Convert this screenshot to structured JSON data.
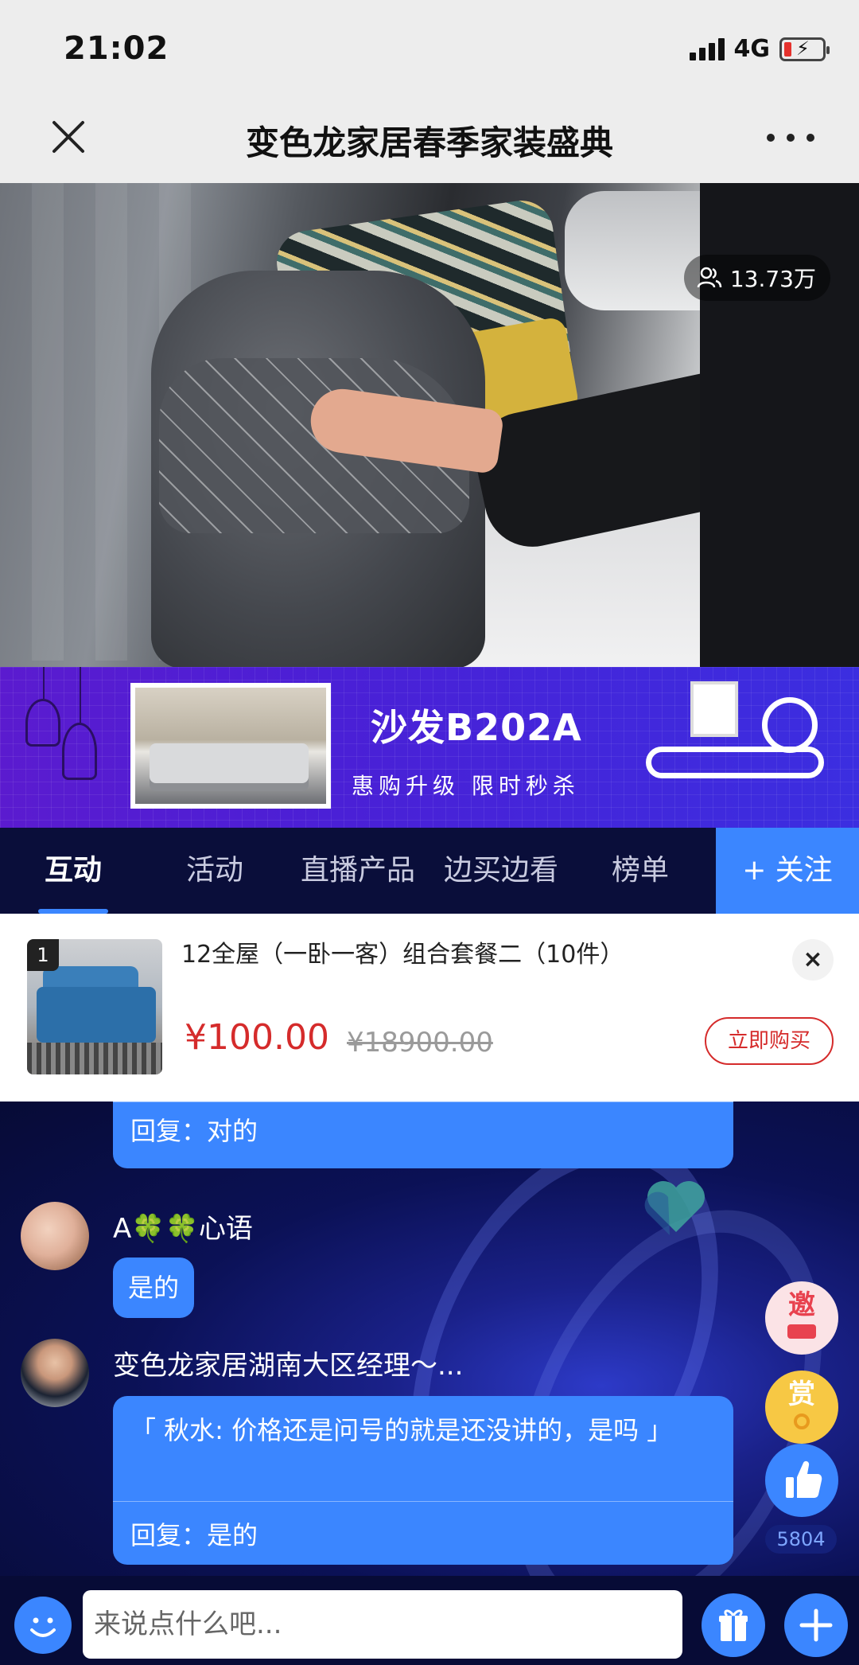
{
  "status_bar": {
    "time": "21:02",
    "network": "4G"
  },
  "nav": {
    "title": "变色龙家居春季家装盛典",
    "close_icon": "close-icon",
    "more_icon": "more-dots-icon"
  },
  "video": {
    "viewer_count": "13.73万",
    "viewer_icon": "people-icon"
  },
  "banner": {
    "title": "沙发B202A",
    "subtitle": "惠购升级 限时秒杀"
  },
  "tabs": [
    {
      "label": "互动",
      "active": true
    },
    {
      "label": "活动",
      "active": false
    },
    {
      "label": "直播产品",
      "active": false
    },
    {
      "label": "边买边看",
      "active": false
    },
    {
      "label": "榜单",
      "active": false
    }
  ],
  "follow_button": "+ 关注",
  "product": {
    "index": "1",
    "name": "12全屋（一卧一客）组合套餐二（10件）",
    "price": "¥100.00",
    "original_price": "¥18900.00",
    "buy_label": "立即购买",
    "close_label": "×"
  },
  "chat": {
    "messages": [
      {
        "user": "",
        "reply": "回复：对的"
      },
      {
        "user": "A🍀🍀心语",
        "text": "是的"
      },
      {
        "user": "变色龙家居湖南大区经理～...",
        "quote": "「 秋水: 价格还是问号的就是还没讲的，是吗 」",
        "reply": "回复：是的"
      }
    ],
    "invite_label": "邀",
    "reward_label": "赏",
    "like_count": "5804"
  },
  "input": {
    "placeholder": "来说点什么吧..."
  },
  "colors": {
    "accent": "#3b86ff",
    "price": "#d52b2b",
    "banner": "#5b1bcf",
    "dark_bg": "#0a0e3a"
  }
}
